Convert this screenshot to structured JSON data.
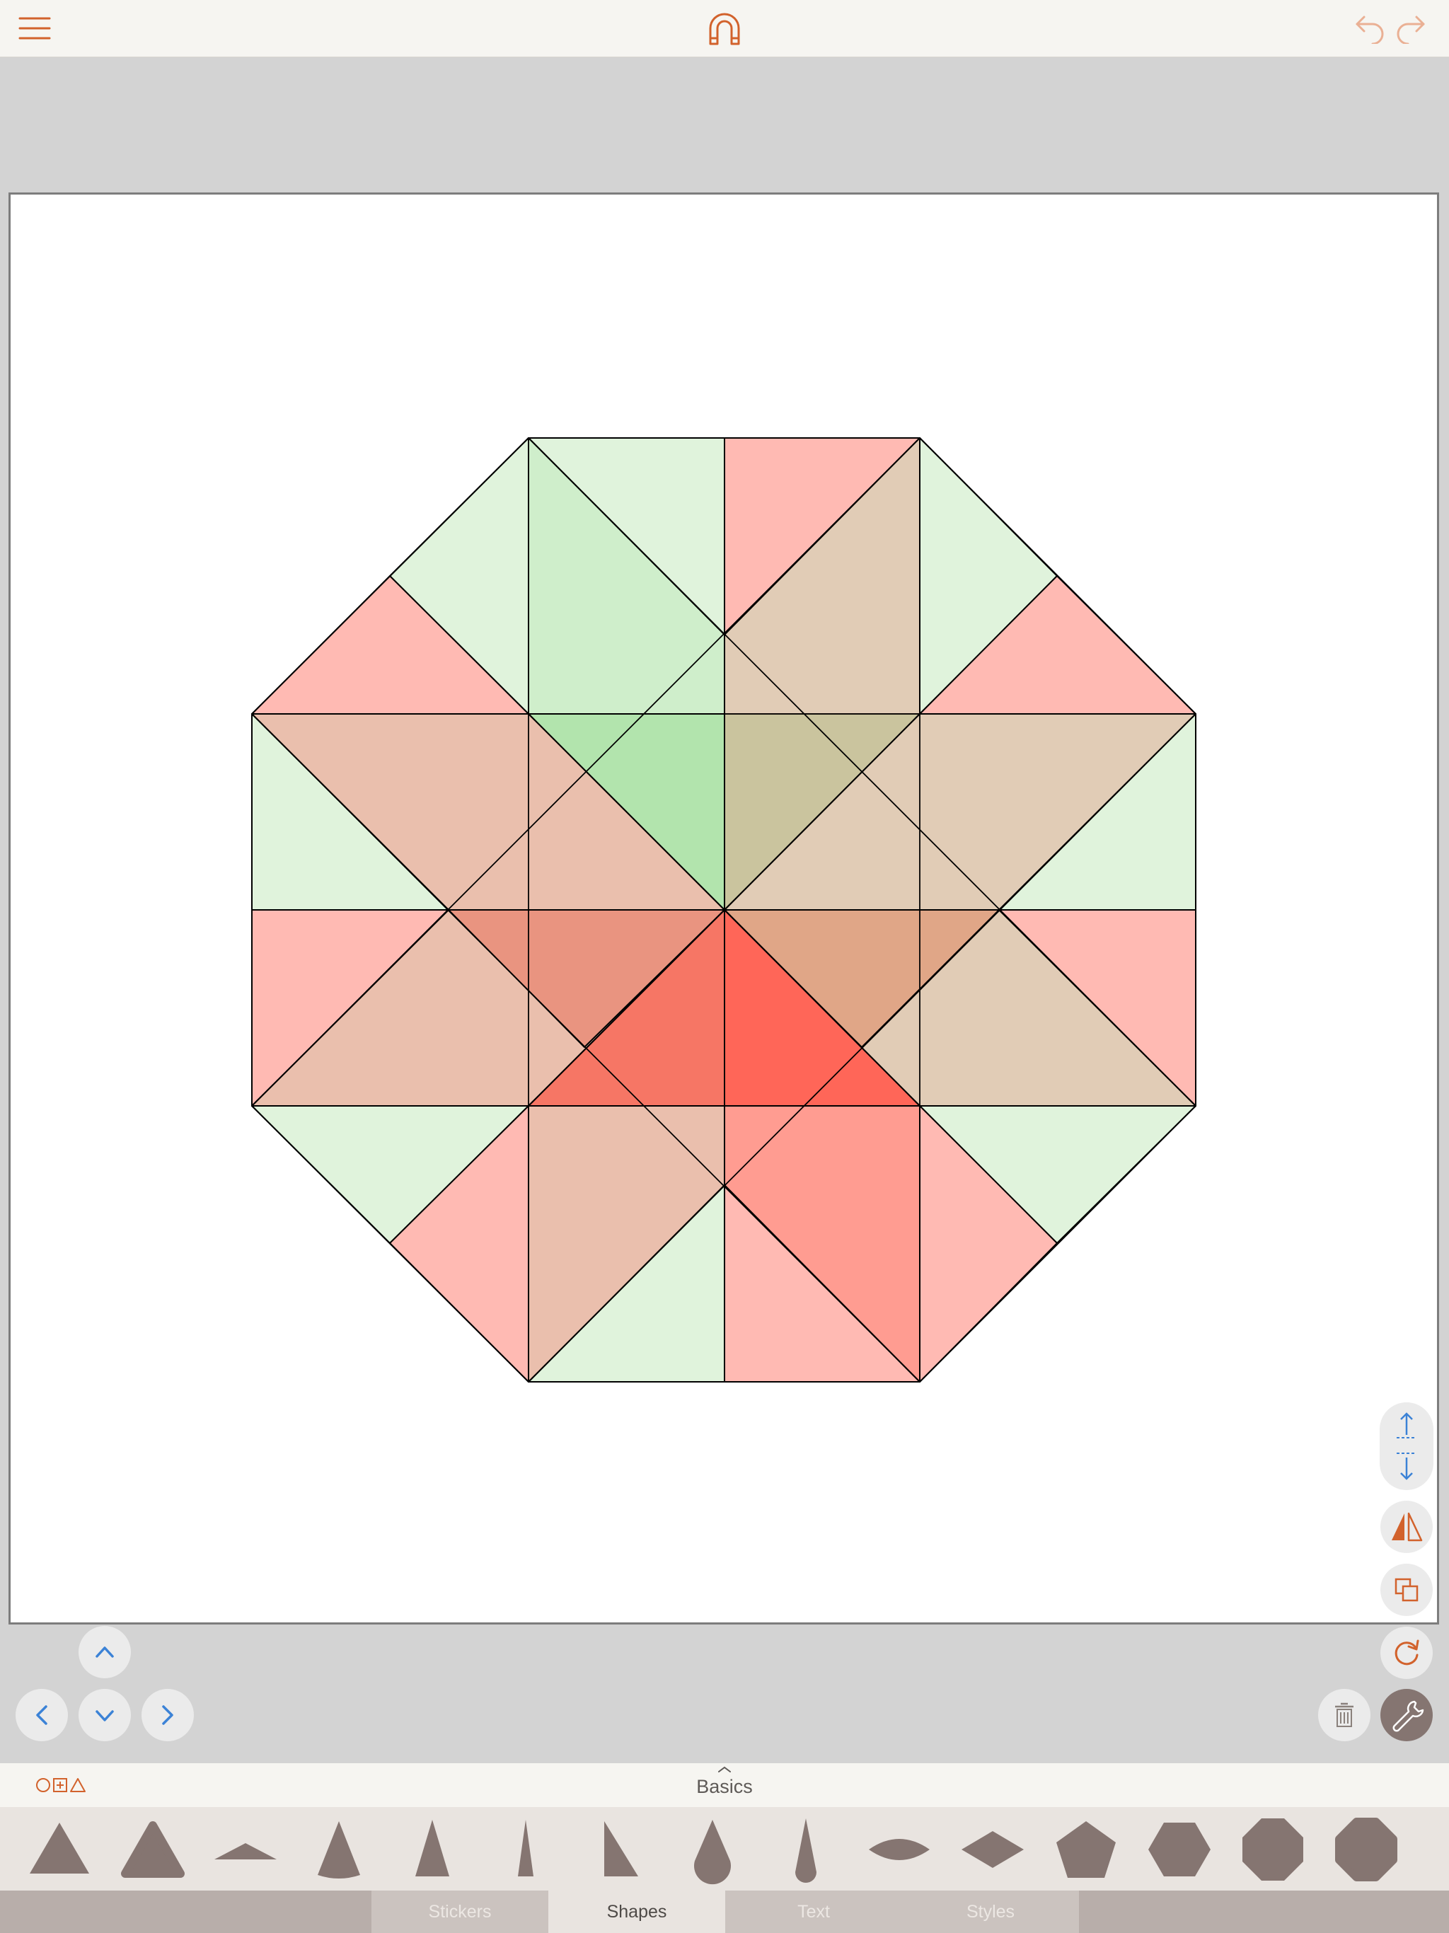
{
  "colors": {
    "accent": "#d2622c",
    "nav_blue": "#3b82d6",
    "shape_fill": "#857571",
    "green_tint": "#ddf2d8",
    "pink_tint": "#ffb2ab",
    "red_center": "#ff3a2a"
  },
  "toolbar": {
    "menu_icon": "hamburger-menu-icon",
    "magnet_icon": "magnet-icon",
    "undo_icon": "undo-icon",
    "redo_icon": "redo-icon"
  },
  "canvas": {
    "artwork": "octagon quilt block of overlapping translucent green and red triangles"
  },
  "right_tools": [
    "bring-forward-icon",
    "send-backward-icon",
    "flip-icon",
    "duplicate-icon",
    "rotate-icon",
    "delete-icon",
    "wrench-icon"
  ],
  "shape_picker": {
    "category_title": "Basics",
    "category_icon": "shape-categories-icon",
    "shapes": [
      "triangle",
      "rounded-triangle",
      "flat-triangle",
      "curved-triangle",
      "tall-triangle",
      "narrow-triangle",
      "right-triangle",
      "teardrop",
      "narrow-teardrop",
      "lens",
      "rhombus",
      "pentagon",
      "hexagon",
      "octagon",
      "rounded-octagon"
    ]
  },
  "tabs": [
    {
      "label": "Stickers",
      "active": false
    },
    {
      "label": "Shapes",
      "active": true
    },
    {
      "label": "Text",
      "active": false
    },
    {
      "label": "Styles",
      "active": false
    }
  ]
}
